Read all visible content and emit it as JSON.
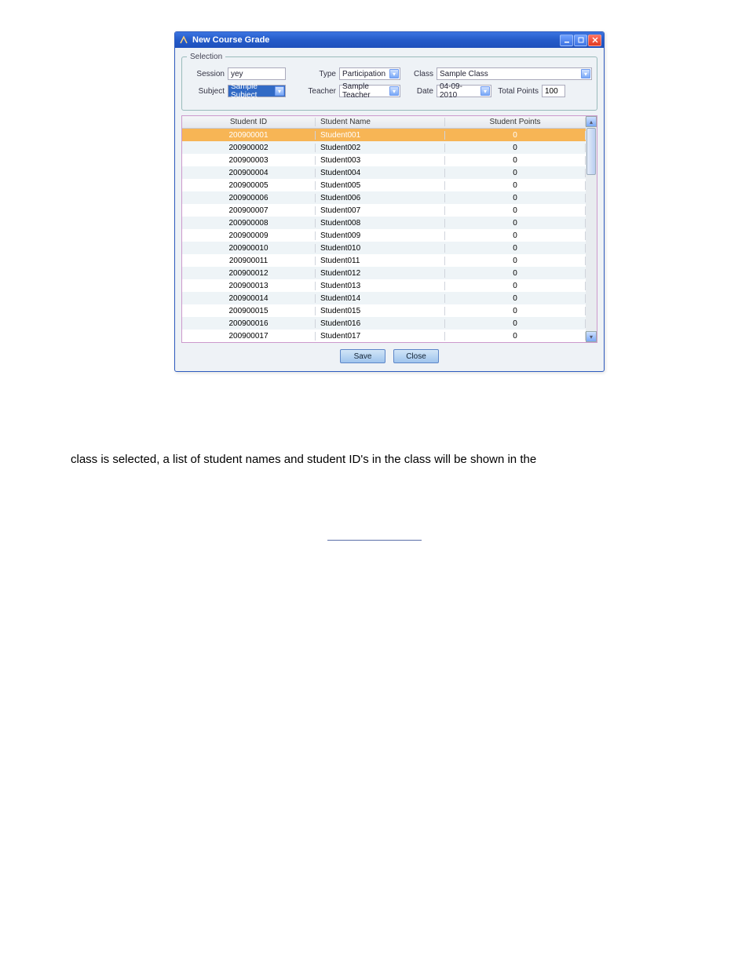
{
  "window": {
    "title": "New Course Grade"
  },
  "selection": {
    "legend": "Selection",
    "labels": {
      "session": "Session",
      "type": "Type",
      "class": "Class",
      "subject": "Subject",
      "teacher": "Teacher",
      "date": "Date",
      "totalPoints": "Total Points"
    },
    "values": {
      "session": "yey",
      "type": "Participation",
      "class": "Sample Class",
      "subject": "Sample Subject",
      "teacher": "Sample Teacher",
      "date": "04-09-2010",
      "totalPoints": "100"
    }
  },
  "table": {
    "headers": {
      "col1": "Student ID",
      "col2": "Student Name",
      "col3": "Student Points"
    },
    "rows": [
      {
        "id": "200900001",
        "name": "Student001",
        "points": "0",
        "sel": true
      },
      {
        "id": "200900002",
        "name": "Student002",
        "points": "0"
      },
      {
        "id": "200900003",
        "name": "Student003",
        "points": "0"
      },
      {
        "id": "200900004",
        "name": "Student004",
        "points": "0"
      },
      {
        "id": "200900005",
        "name": "Student005",
        "points": "0"
      },
      {
        "id": "200900006",
        "name": "Student006",
        "points": "0"
      },
      {
        "id": "200900007",
        "name": "Student007",
        "points": "0"
      },
      {
        "id": "200900008",
        "name": "Student008",
        "points": "0"
      },
      {
        "id": "200900009",
        "name": "Student009",
        "points": "0"
      },
      {
        "id": "200900010",
        "name": "Student010",
        "points": "0"
      },
      {
        "id": "200900011",
        "name": "Student011",
        "points": "0"
      },
      {
        "id": "200900012",
        "name": "Student012",
        "points": "0"
      },
      {
        "id": "200900013",
        "name": "Student013",
        "points": "0"
      },
      {
        "id": "200900014",
        "name": "Student014",
        "points": "0"
      },
      {
        "id": "200900015",
        "name": "Student015",
        "points": "0"
      },
      {
        "id": "200900016",
        "name": "Student016",
        "points": "0"
      },
      {
        "id": "200900017",
        "name": "Student017",
        "points": "0"
      }
    ]
  },
  "buttons": {
    "save": "Save",
    "close": "Close"
  },
  "bodyText": "class is selected, a list of student names and student ID's in the class will be shown in the"
}
